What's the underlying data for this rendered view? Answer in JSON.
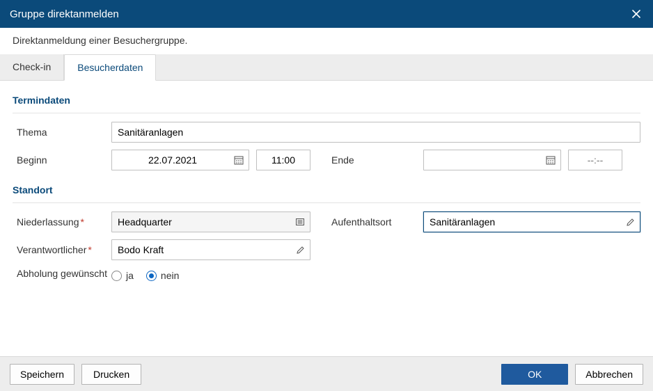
{
  "header": {
    "title": "Gruppe direktanmelden"
  },
  "subtitle": "Direktanmeldung einer Besuchergruppe.",
  "tabs": {
    "checkin": "Check-in",
    "besucherdaten": "Besucherdaten"
  },
  "sections": {
    "termindaten": "Termindaten",
    "standort": "Standort"
  },
  "labels": {
    "thema": "Thema",
    "beginn": "Beginn",
    "ende": "Ende",
    "niederlassung": "Niederlassung",
    "aufenthaltsort": "Aufenthaltsort",
    "verantwortlicher": "Verantwortlicher",
    "abholung": "Abholung gewünscht",
    "ja": "ja",
    "nein": "nein"
  },
  "values": {
    "thema": "Sanitäranlagen",
    "beginn_date": "22.07.2021",
    "beginn_time": "11:00",
    "ende_date": "",
    "ende_time_placeholder": "--:--",
    "niederlassung": "Headquarter",
    "aufenthaltsort": "Sanitäranlagen",
    "verantwortlicher": "Bodo Kraft",
    "abholung": "nein"
  },
  "footer": {
    "speichern": "Speichern",
    "drucken": "Drucken",
    "ok": "OK",
    "abbrechen": "Abbrechen"
  }
}
